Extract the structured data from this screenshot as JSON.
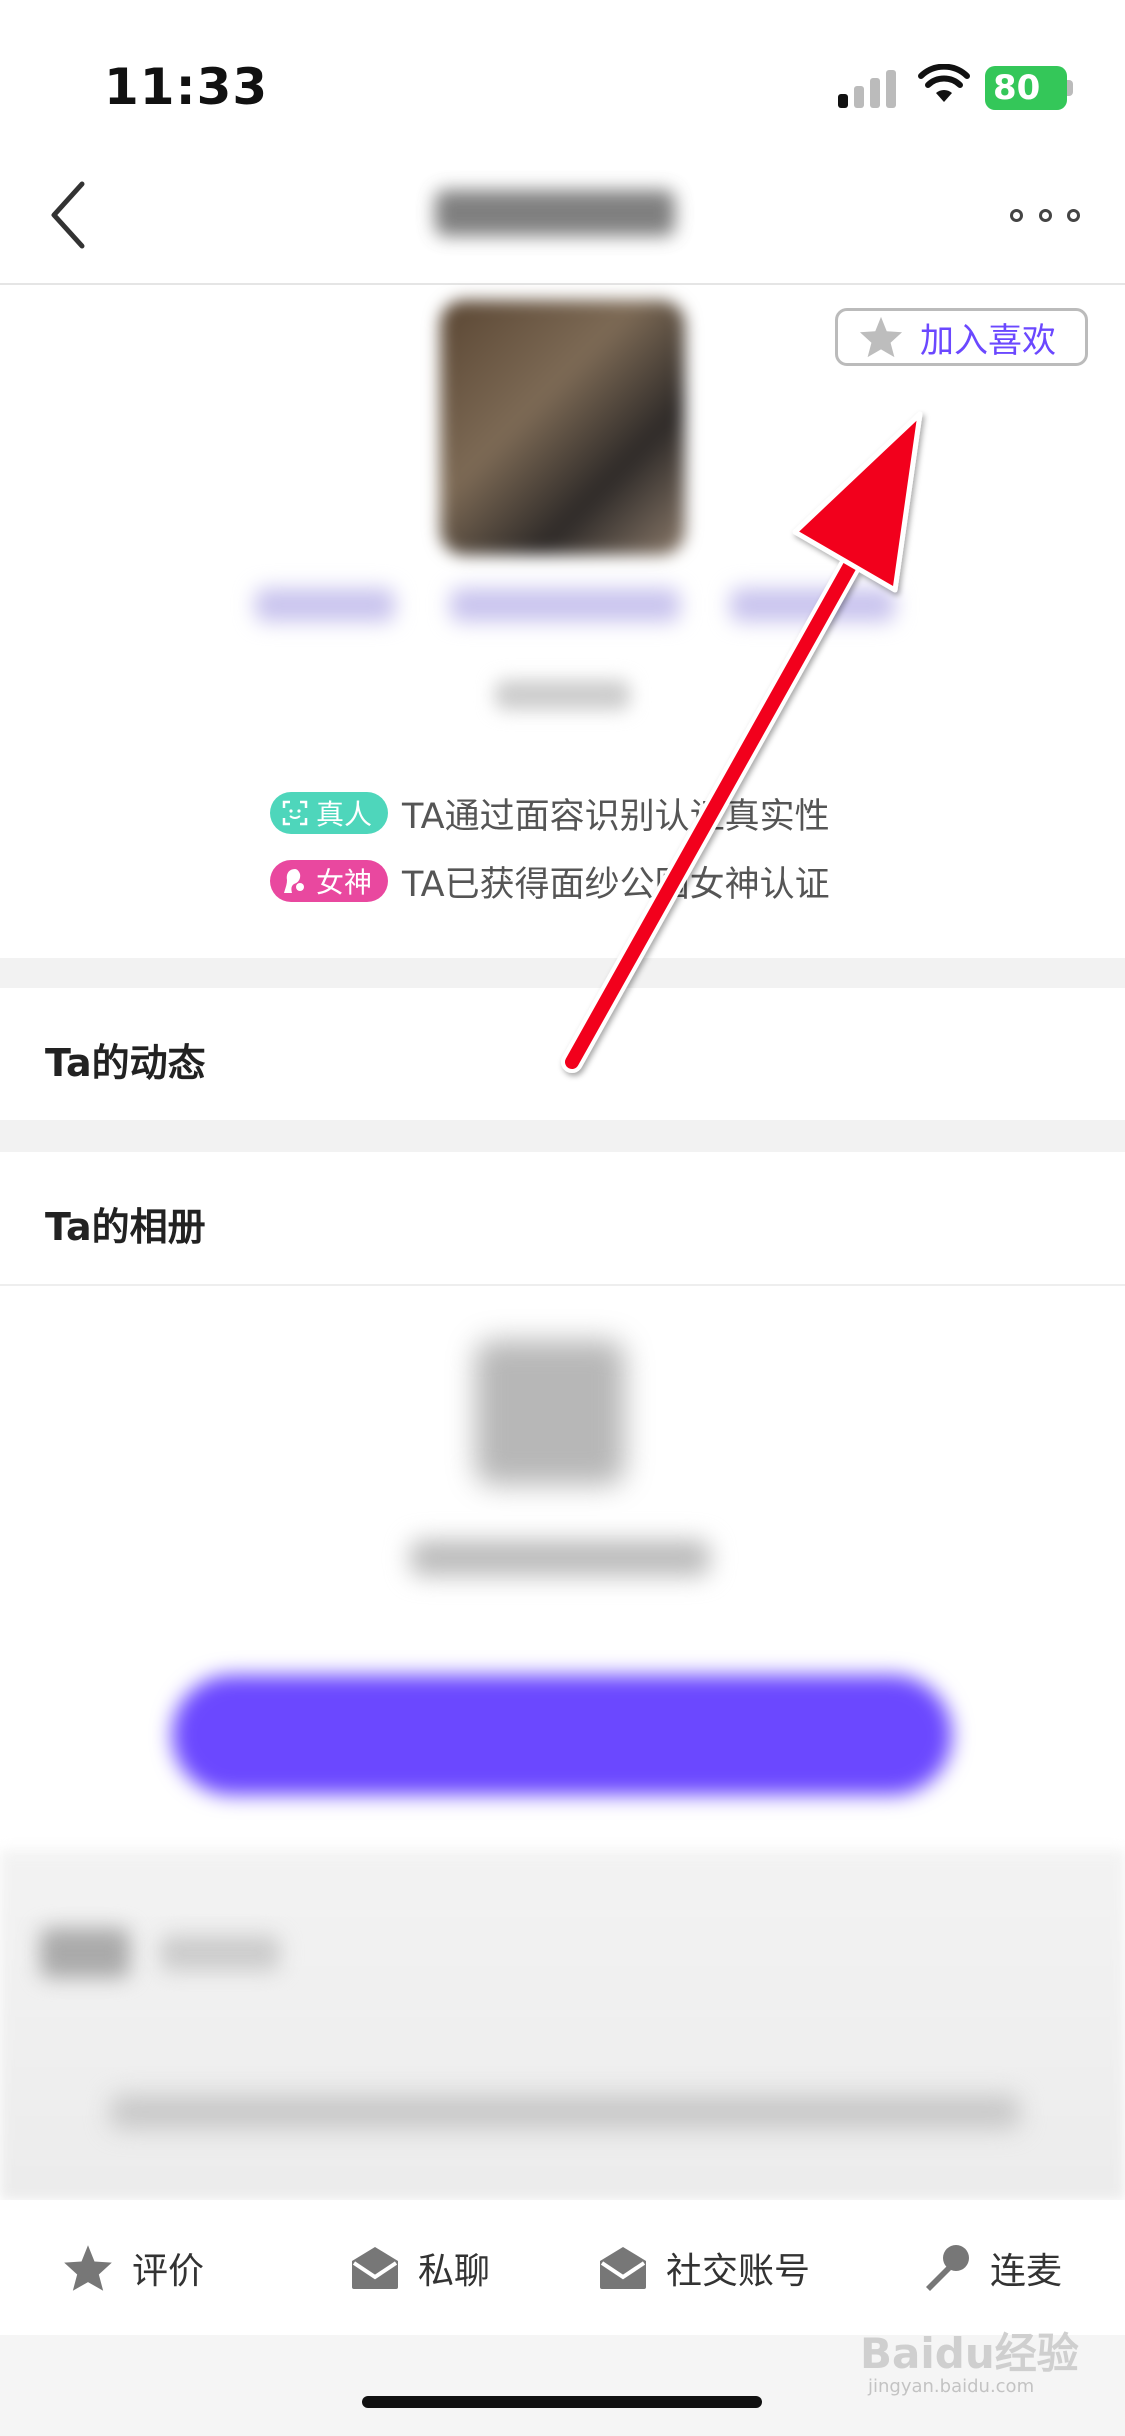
{
  "status_bar": {
    "time": "11:33",
    "battery": "80"
  },
  "nav": {
    "back_icon": "chevron-left-icon",
    "more_icon": "more-dots-icon"
  },
  "profile": {
    "favorite_label": "加入喜欢",
    "favorite_icon": "star-icon"
  },
  "verifications": [
    {
      "badge": "真人",
      "text": "TA通过面容识别认证真实性",
      "color": "#4ed6bb",
      "icon": "face-scan-icon"
    },
    {
      "badge": "女神",
      "text": "TA已获得面纱公园女神认证",
      "color": "#e9489f",
      "icon": "goddess-icon"
    }
  ],
  "sections": {
    "moments_title": "Ta的动态",
    "album_title": "Ta的相册"
  },
  "bottom_tabs": [
    {
      "label": "评价",
      "icon": "star-icon"
    },
    {
      "label": "私聊",
      "icon": "mail-icon"
    },
    {
      "label": "社交账号",
      "icon": "mail-icon"
    },
    {
      "label": "连麦",
      "icon": "microphone-icon"
    }
  ],
  "watermark": {
    "text": "Baidu经验",
    "sub": "jingyan.baidu.com"
  },
  "colors": {
    "accent": "#6b48ff",
    "annotation": "#ff0000"
  }
}
